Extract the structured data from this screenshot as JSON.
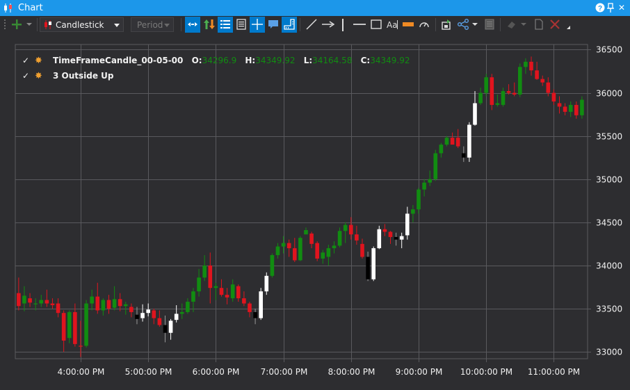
{
  "window": {
    "title": "Chart",
    "icon": "candlestick-icon",
    "buttons": [
      "help-icon",
      "pin-icon",
      "close-icon"
    ],
    "help_glyph": "?",
    "close_glyph": "✕"
  },
  "toolbar": {
    "chart_type": "Candlestick",
    "period_placeholder": "Period",
    "buttons": [
      "add-icon",
      "dropdown-icon",
      "axis-scroll-icon",
      "up-down-arrows-icon",
      "indicators-list-icon",
      "data-table-icon",
      "crosshair-icon",
      "annotation-icon",
      "ruler-icon",
      "line-tool-icon",
      "arrow-tool-icon",
      "vertical-line-icon",
      "horizontal-line-icon",
      "rectangle-tool-icon",
      "text-tool-icon",
      "highlight-icon",
      "gauge-icon",
      "save-icon",
      "share-icon",
      "export-icon",
      "eraser-icon",
      "document-icon",
      "delete-icon"
    ]
  },
  "legend": [
    {
      "checked": true,
      "icon": "gear-icon",
      "name": "TimeFrameCandle_00-05-00",
      "o_label": "O:",
      "o": "34296.9",
      "h_label": "H:",
      "h": "34349.92",
      "l_label": "L:",
      "l": "34164.58",
      "c_label": "C:",
      "c": "34349.92"
    },
    {
      "checked": true,
      "icon": "gear-icon",
      "name": "3 Outside Up"
    }
  ],
  "colors": {
    "background": "#2d2d30",
    "grid": "#5a5a5e",
    "up": "#118c11",
    "down": "#e0141e",
    "pattern_up": "#ffffff",
    "pattern_down": "#000000",
    "axis_text": "#f1f1f1",
    "accent": "#1c97ea"
  },
  "chart_data": {
    "type": "candlestick",
    "x_ticks": [
      "4:00:00 PM",
      "5:00:00 PM",
      "6:00:00 PM",
      "7:00:00 PM",
      "8:00:00 PM",
      "9:00:00 PM",
      "10:00:00 PM",
      "11:00:00 PM"
    ],
    "y_ticks": [
      33000,
      33500,
      34000,
      34500,
      35000,
      35500,
      36000,
      36500
    ],
    "ylim": [
      32920,
      36560
    ],
    "x_range_hours": [
      "3:05 PM",
      "11:30 PM"
    ],
    "grid": true,
    "candles": [
      {
        "t": "15:05",
        "o": 33680,
        "h": 33860,
        "l": 33480,
        "c": 33530
      },
      {
        "t": "15:10",
        "o": 33560,
        "h": 33760,
        "l": 33470,
        "c": 33650
      },
      {
        "t": "15:15",
        "o": 33620,
        "h": 33680,
        "l": 33520,
        "c": 33570
      },
      {
        "t": "15:20",
        "o": 33550,
        "h": 33620,
        "l": 33480,
        "c": 33560
      },
      {
        "t": "15:25",
        "o": 33560,
        "h": 33660,
        "l": 33520,
        "c": 33600
      },
      {
        "t": "15:30",
        "o": 33600,
        "h": 33720,
        "l": 33520,
        "c": 33560
      },
      {
        "t": "15:35",
        "o": 33560,
        "h": 33620,
        "l": 33500,
        "c": 33540
      },
      {
        "t": "15:40",
        "o": 33560,
        "h": 33620,
        "l": 33400,
        "c": 33450
      },
      {
        "t": "15:45",
        "o": 33450,
        "h": 33480,
        "l": 33000,
        "c": 33130
      },
      {
        "t": "15:50",
        "o": 33160,
        "h": 33480,
        "l": 33100,
        "c": 33460
      },
      {
        "t": "15:55",
        "o": 33460,
        "h": 33560,
        "l": 33060,
        "c": 33090
      },
      {
        "t": "16:00",
        "o": 33070,
        "h": 33360,
        "l": 32940,
        "c": 33060
      },
      {
        "t": "16:05",
        "o": 33070,
        "h": 33600,
        "l": 33050,
        "c": 33560
      },
      {
        "t": "16:10",
        "o": 33560,
        "h": 33720,
        "l": 33480,
        "c": 33640
      },
      {
        "t": "16:15",
        "o": 33640,
        "h": 33800,
        "l": 33440,
        "c": 33480
      },
      {
        "t": "16:20",
        "o": 33480,
        "h": 33620,
        "l": 33420,
        "c": 33600
      },
      {
        "t": "16:25",
        "o": 33600,
        "h": 33660,
        "l": 33440,
        "c": 33500
      },
      {
        "t": "16:30",
        "o": 33510,
        "h": 33760,
        "l": 33480,
        "c": 33610
      },
      {
        "t": "16:35",
        "o": 33610,
        "h": 33680,
        "l": 33470,
        "c": 33530
      },
      {
        "t": "16:40",
        "o": 33530,
        "h": 33580,
        "l": 33430,
        "c": 33550
      },
      {
        "t": "16:45",
        "o": 33520,
        "h": 33560,
        "l": 33400,
        "c": 33460
      },
      {
        "t": "16:50",
        "o": 33430,
        "h": 33520,
        "l": 33320,
        "c": 33380,
        "pattern": true
      },
      {
        "t": "16:55",
        "o": 33390,
        "h": 33550,
        "l": 33350,
        "c": 33450,
        "pattern": true
      },
      {
        "t": "17:00",
        "o": 33450,
        "h": 33560,
        "l": 33410,
        "c": 33490,
        "pattern": true
      },
      {
        "t": "17:05",
        "o": 33480,
        "h": 33500,
        "l": 33320,
        "c": 33390
      },
      {
        "t": "17:10",
        "o": 33390,
        "h": 33480,
        "l": 33290,
        "c": 33310
      },
      {
        "t": "17:15",
        "o": 33310,
        "h": 33420,
        "l": 33110,
        "c": 33220,
        "pattern": true
      },
      {
        "t": "17:20",
        "o": 33220,
        "h": 33380,
        "l": 33140,
        "c": 33360,
        "pattern": true
      },
      {
        "t": "17:25",
        "o": 33370,
        "h": 33540,
        "l": 33340,
        "c": 33440,
        "pattern": true
      },
      {
        "t": "17:30",
        "o": 33440,
        "h": 33560,
        "l": 33380,
        "c": 33460
      },
      {
        "t": "17:35",
        "o": 33460,
        "h": 33620,
        "l": 33440,
        "c": 33580
      },
      {
        "t": "17:40",
        "o": 33580,
        "h": 33740,
        "l": 33460,
        "c": 33700
      },
      {
        "t": "17:45",
        "o": 33700,
        "h": 33960,
        "l": 33640,
        "c": 33860
      },
      {
        "t": "17:50",
        "o": 33860,
        "h": 34120,
        "l": 33820,
        "c": 34000
      },
      {
        "t": "17:55",
        "o": 34000,
        "h": 34150,
        "l": 33560,
        "c": 33740
      },
      {
        "t": "18:00",
        "o": 33740,
        "h": 33800,
        "l": 33600,
        "c": 33760
      },
      {
        "t": "18:05",
        "o": 33740,
        "h": 33840,
        "l": 33640,
        "c": 33660
      },
      {
        "t": "18:10",
        "o": 33660,
        "h": 33740,
        "l": 33550,
        "c": 33630
      },
      {
        "t": "18:15",
        "o": 33620,
        "h": 33840,
        "l": 33580,
        "c": 33780
      },
      {
        "t": "18:20",
        "o": 33760,
        "h": 33780,
        "l": 33580,
        "c": 33620
      },
      {
        "t": "18:25",
        "o": 33620,
        "h": 33700,
        "l": 33530,
        "c": 33560
      },
      {
        "t": "18:30",
        "o": 33560,
        "h": 33580,
        "l": 33400,
        "c": 33460
      },
      {
        "t": "18:35",
        "o": 33460,
        "h": 33500,
        "l": 33320,
        "c": 33390,
        "pattern": true
      },
      {
        "t": "18:40",
        "o": 33390,
        "h": 33740,
        "l": 33370,
        "c": 33700,
        "pattern": true
      },
      {
        "t": "18:45",
        "o": 33700,
        "h": 33920,
        "l": 33660,
        "c": 33880,
        "pattern": true
      },
      {
        "t": "18:50",
        "o": 33880,
        "h": 34140,
        "l": 33860,
        "c": 34120
      },
      {
        "t": "18:55",
        "o": 34120,
        "h": 34260,
        "l": 34080,
        "c": 34220
      },
      {
        "t": "19:00",
        "o": 34220,
        "h": 34340,
        "l": 34140,
        "c": 34260
      },
      {
        "t": "19:05",
        "o": 34260,
        "h": 34300,
        "l": 34100,
        "c": 34200
      },
      {
        "t": "19:10",
        "o": 34200,
        "h": 34320,
        "l": 34040,
        "c": 34060
      },
      {
        "t": "19:15",
        "o": 34060,
        "h": 34340,
        "l": 34050,
        "c": 34320
      },
      {
        "t": "19:20",
        "o": 34360,
        "h": 34440,
        "l": 34380,
        "c": 34410
      },
      {
        "t": "19:25",
        "o": 34370,
        "h": 34390,
        "l": 34200,
        "c": 34250
      },
      {
        "t": "19:30",
        "o": 34260,
        "h": 34280,
        "l": 34050,
        "c": 34080
      },
      {
        "t": "19:35",
        "o": 34080,
        "h": 34180,
        "l": 34020,
        "c": 34150
      },
      {
        "t": "19:40",
        "o": 34100,
        "h": 34240,
        "l": 34000,
        "c": 34200
      },
      {
        "t": "19:45",
        "o": 34200,
        "h": 34280,
        "l": 34140,
        "c": 34230
      },
      {
        "t": "19:50",
        "o": 34230,
        "h": 34440,
        "l": 34210,
        "c": 34400
      },
      {
        "t": "19:55",
        "o": 34400,
        "h": 34500,
        "l": 34260,
        "c": 34470
      },
      {
        "t": "20:00",
        "o": 34470,
        "h": 34560,
        "l": 34300,
        "c": 34360
      },
      {
        "t": "20:05",
        "o": 34360,
        "h": 34460,
        "l": 34240,
        "c": 34290
      },
      {
        "t": "20:10",
        "o": 34250,
        "h": 34310,
        "l": 34080,
        "c": 34100
      },
      {
        "t": "20:15",
        "o": 34100,
        "h": 34160,
        "l": 33820,
        "c": 33840,
        "pattern": true
      },
      {
        "t": "20:20",
        "o": 33840,
        "h": 34220,
        "l": 33820,
        "c": 34200,
        "pattern": true
      },
      {
        "t": "20:25",
        "o": 34200,
        "h": 34460,
        "l": 34190,
        "c": 34420,
        "pattern": true
      },
      {
        "t": "20:30",
        "o": 34420,
        "h": 34480,
        "l": 34340,
        "c": 34390
      },
      {
        "t": "20:35",
        "o": 34390,
        "h": 34400,
        "l": 34250,
        "c": 34330
      },
      {
        "t": "20:40",
        "o": 34330,
        "h": 34380,
        "l": 34230,
        "c": 34300,
        "pattern": true
      },
      {
        "t": "20:45",
        "o": 34300,
        "h": 34380,
        "l": 34200,
        "c": 34340,
        "pattern": true
      },
      {
        "t": "20:50",
        "o": 34350,
        "h": 34680,
        "l": 34300,
        "c": 34600,
        "pattern": true
      },
      {
        "t": "20:55",
        "o": 34600,
        "h": 34700,
        "l": 34500,
        "c": 34650
      },
      {
        "t": "21:00",
        "o": 34650,
        "h": 34900,
        "l": 34600,
        "c": 34880
      },
      {
        "t": "21:05",
        "o": 34880,
        "h": 35000,
        "l": 34800,
        "c": 34960
      },
      {
        "t": "21:10",
        "o": 34960,
        "h": 35100,
        "l": 34920,
        "c": 35000
      },
      {
        "t": "21:15",
        "o": 35000,
        "h": 35340,
        "l": 34980,
        "c": 35300
      },
      {
        "t": "21:20",
        "o": 35300,
        "h": 35420,
        "l": 35250,
        "c": 35400
      },
      {
        "t": "21:25",
        "o": 35400,
        "h": 35500,
        "l": 35380,
        "c": 35480
      },
      {
        "t": "21:30",
        "o": 35480,
        "h": 35540,
        "l": 35420,
        "c": 35400
      },
      {
        "t": "21:35",
        "o": 35480,
        "h": 35580,
        "l": 35360,
        "c": 35380
      },
      {
        "t": "21:40",
        "o": 35300,
        "h": 35380,
        "l": 35200,
        "c": 35250,
        "pattern": true
      },
      {
        "t": "21:45",
        "o": 35250,
        "h": 35660,
        "l": 35200,
        "c": 35630,
        "pattern": true
      },
      {
        "t": "21:50",
        "o": 35630,
        "h": 36020,
        "l": 35620,
        "c": 35880,
        "pattern": true
      },
      {
        "t": "21:55",
        "o": 35880,
        "h": 36060,
        "l": 35860,
        "c": 36000
      },
      {
        "t": "22:00",
        "o": 36000,
        "h": 36220,
        "l": 35960,
        "c": 36180
      },
      {
        "t": "22:05",
        "o": 36180,
        "h": 36220,
        "l": 35800,
        "c": 35860
      },
      {
        "t": "22:10",
        "o": 35860,
        "h": 35980,
        "l": 35840,
        "c": 35880
      },
      {
        "t": "22:15",
        "o": 35860,
        "h": 36060,
        "l": 35840,
        "c": 36020
      },
      {
        "t": "22:20",
        "o": 36020,
        "h": 36100,
        "l": 35980,
        "c": 36000
      },
      {
        "t": "22:25",
        "o": 36000,
        "h": 36120,
        "l": 35960,
        "c": 35980
      },
      {
        "t": "22:30",
        "o": 35980,
        "h": 36340,
        "l": 35950,
        "c": 36300
      },
      {
        "t": "22:35",
        "o": 36300,
        "h": 36400,
        "l": 36220,
        "c": 36360
      },
      {
        "t": "22:40",
        "o": 36360,
        "h": 36420,
        "l": 36200,
        "c": 36260
      },
      {
        "t": "22:45",
        "o": 36260,
        "h": 36360,
        "l": 36150,
        "c": 36160
      },
      {
        "t": "22:50",
        "o": 36160,
        "h": 36200,
        "l": 36080,
        "c": 36120
      },
      {
        "t": "22:55",
        "o": 36120,
        "h": 36180,
        "l": 35960,
        "c": 36000
      },
      {
        "t": "23:00",
        "o": 36000,
        "h": 36040,
        "l": 35860,
        "c": 35900
      },
      {
        "t": "23:05",
        "o": 35880,
        "h": 35960,
        "l": 35760,
        "c": 35840
      },
      {
        "t": "23:10",
        "o": 35840,
        "h": 35880,
        "l": 35740,
        "c": 35780
      },
      {
        "t": "23:15",
        "o": 35780,
        "h": 35900,
        "l": 35720,
        "c": 35860
      },
      {
        "t": "23:20",
        "o": 35860,
        "h": 35900,
        "l": 35700,
        "c": 35740
      },
      {
        "t": "23:25",
        "o": 35740,
        "h": 35960,
        "l": 35700,
        "c": 35920
      }
    ]
  }
}
